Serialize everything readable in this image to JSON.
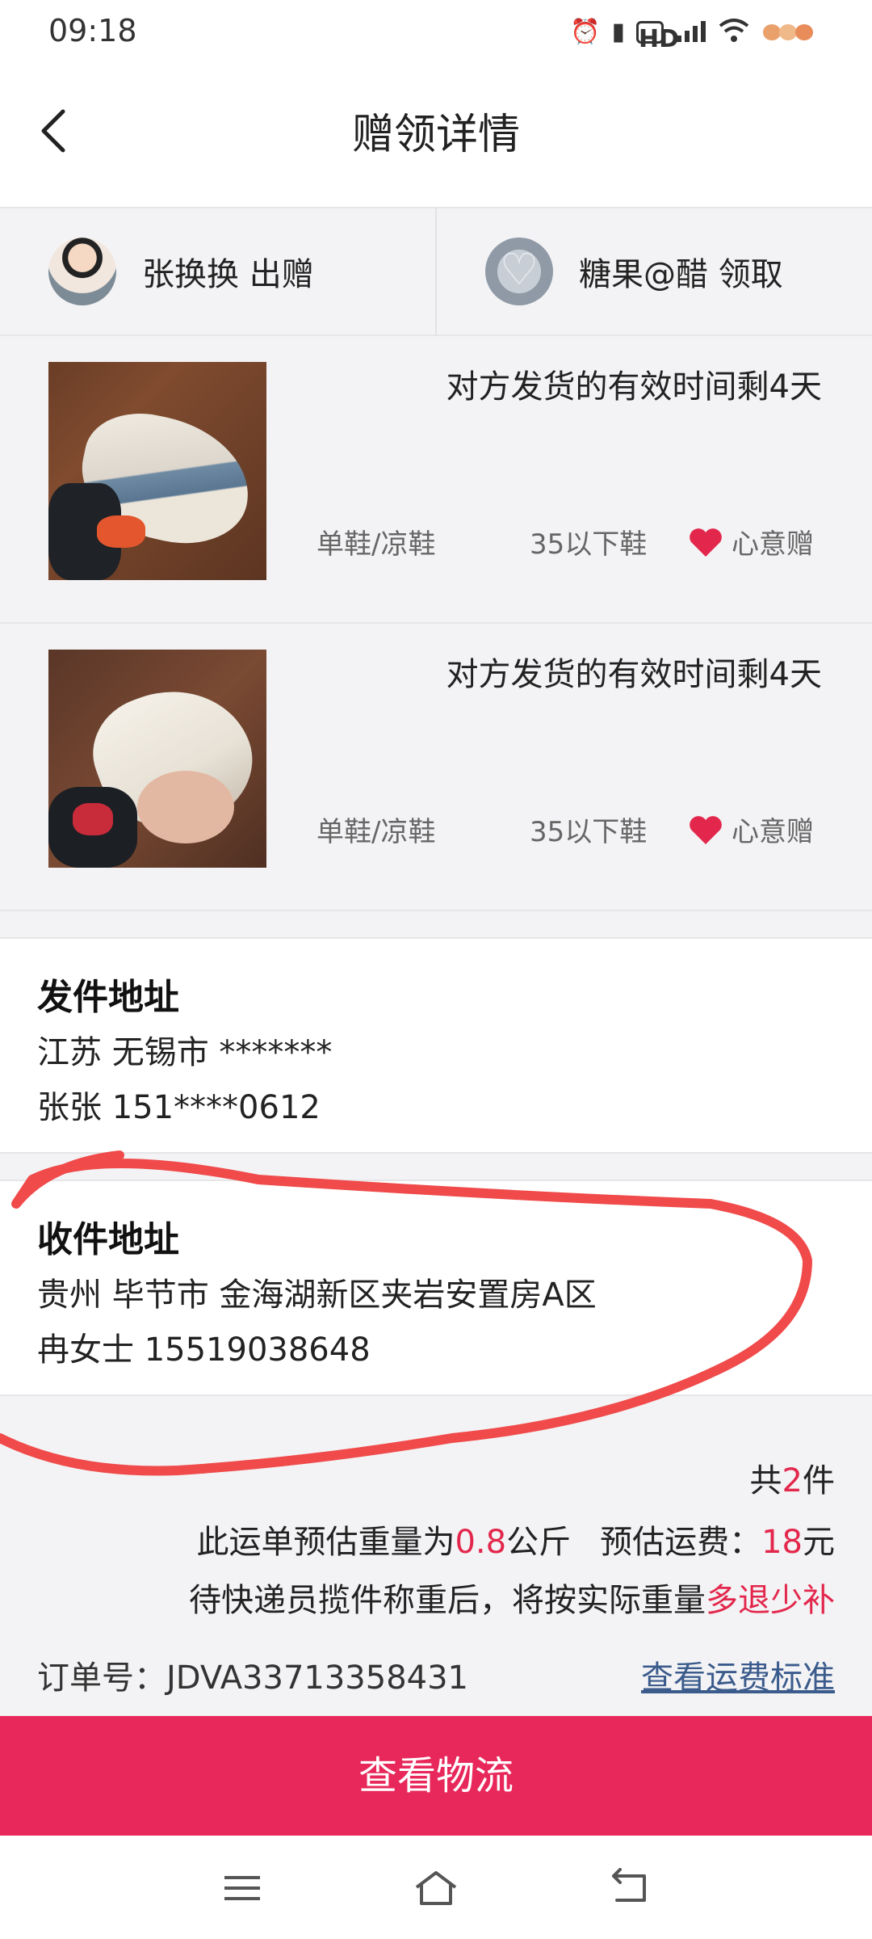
{
  "status_bar": {
    "time": "09:18",
    "icons": [
      "alarm-icon",
      "vibrate-icon",
      "hd-icon",
      "signal-5g-icon",
      "wifi-icon",
      "notification-fruit-icon"
    ],
    "hd_label": "HD"
  },
  "header": {
    "title": "赠领详情",
    "back_icon": "back-chevron-icon"
  },
  "users": {
    "giver": "张换换 出赠",
    "receiver": "糖果@醋 领取"
  },
  "items": [
    {
      "deadline": "对方发货的有效时间剩4天",
      "category": "单鞋/凉鞋",
      "size": "35以下鞋",
      "gift_type": "心意赠"
    },
    {
      "deadline": "对方发货的有效时间剩4天",
      "category": "单鞋/凉鞋",
      "size": "35以下鞋",
      "gift_type": "心意赠"
    }
  ],
  "ship_from": {
    "title": "发件地址",
    "address": "江苏 无锡市 *******",
    "contact": "张张 151****0612"
  },
  "ship_to": {
    "title": "收件地址",
    "address": "贵州 毕节市 金海湖新区夹岩安置房A区",
    "contact": "冉女士 15519038648"
  },
  "summary": {
    "count_prefix": "共",
    "count": "2",
    "count_suffix": "件",
    "weight_prefix": "此运单预估重量为",
    "weight": "0.8",
    "weight_unit": "公斤",
    "fee_prefix": "预估运费：",
    "fee": "18",
    "fee_unit": "元",
    "note_prefix": "待快递员揽件称重后，将按实际重量",
    "note_highlight": "多退少补"
  },
  "order": {
    "label": "订单号：JDVA33713358431",
    "fee_standard_link": "查看运费标准"
  },
  "action": {
    "view_logistics": "查看物流"
  },
  "colors": {
    "accent": "#e8285a",
    "highlight": "#e3274c",
    "link": "#3b5b8c",
    "annotation": "#f04a4a"
  }
}
